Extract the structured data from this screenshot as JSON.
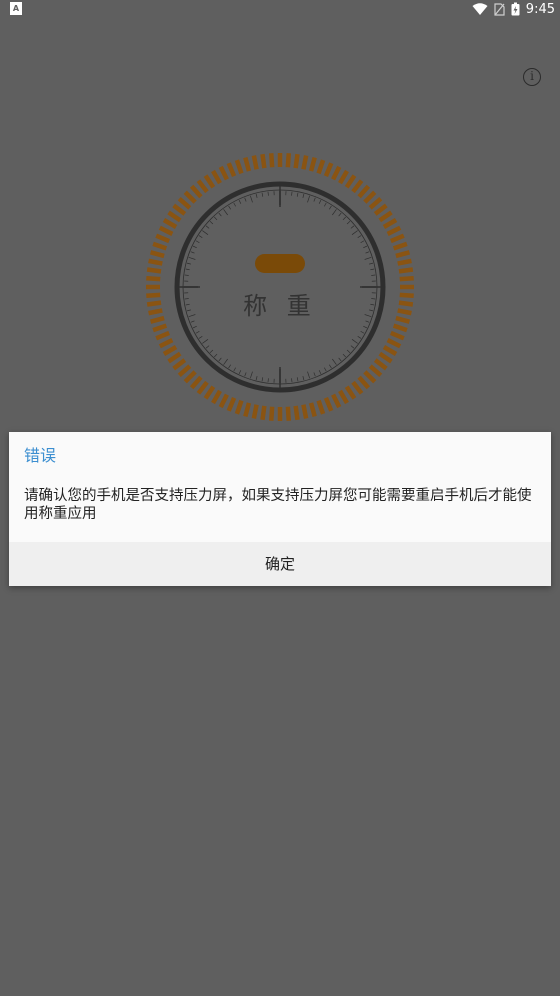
{
  "status_bar": {
    "notification_icon": "a-notification-icon",
    "icons": [
      "wifi-icon",
      "sim-icon",
      "battery-charging-icon"
    ],
    "time": "9:45"
  },
  "toolbar": {
    "info_icon": "info-icon"
  },
  "scale": {
    "label": "称 重",
    "colors": {
      "accent": "#8a5412",
      "dial_ring": "#2e2e2e",
      "pill": "#7a4a08"
    }
  },
  "dialog": {
    "title": "错误",
    "message": "请确认您的手机是否支持压力屏，如果支持压力屏您可能需要重启手机后才能使用称重应用",
    "confirm_label": "确定",
    "colors": {
      "title": "#3b8ed0",
      "background": "#fafafa",
      "action_bar": "#efefef"
    }
  },
  "colors": {
    "overlay_background": "#5f5f5f"
  }
}
